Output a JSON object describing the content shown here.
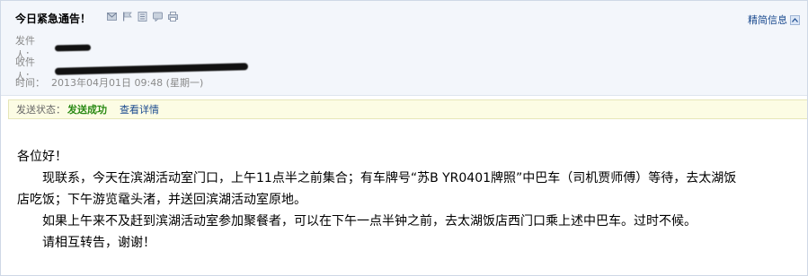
{
  "header": {
    "subject": "今日紧急通告！",
    "detail_link": "精简信息",
    "icons": [
      "mail-icon",
      "flag-icon",
      "notes-icon",
      "message-icon",
      "print-icon"
    ]
  },
  "meta": {
    "from_label": "发件人：",
    "to_label": "收件人：",
    "time_label": "时间：",
    "time_value": "2013年04月01日 09:48 (星期一)"
  },
  "status": {
    "label": "发送状态：",
    "value": "发送成功",
    "detail_link": "查看详情"
  },
  "body": {
    "greeting": "各位好！",
    "para1_line1": "现联系，今天在滨湖活动室门口，上午11点半之前集合；有车牌号“苏B YR0401牌照”中巴车（司机贾师傅）等待，去太湖饭",
    "para1_line2": "店吃饭；下午游览鼋头渚，并送回滨湖活动室原地。",
    "para2": "如果上午来不及赶到滨湖活动室参加聚餐者，可以在下午一点半钟之前，去太湖饭店西门口乘上述中巴车。过时不候。",
    "para3": "请相互转告，谢谢！"
  },
  "colors": {
    "header_bg": "#f3f6fb",
    "status_bg": "#fcfce4",
    "status_success": "#2a8a14",
    "link": "#1a4a8f"
  }
}
